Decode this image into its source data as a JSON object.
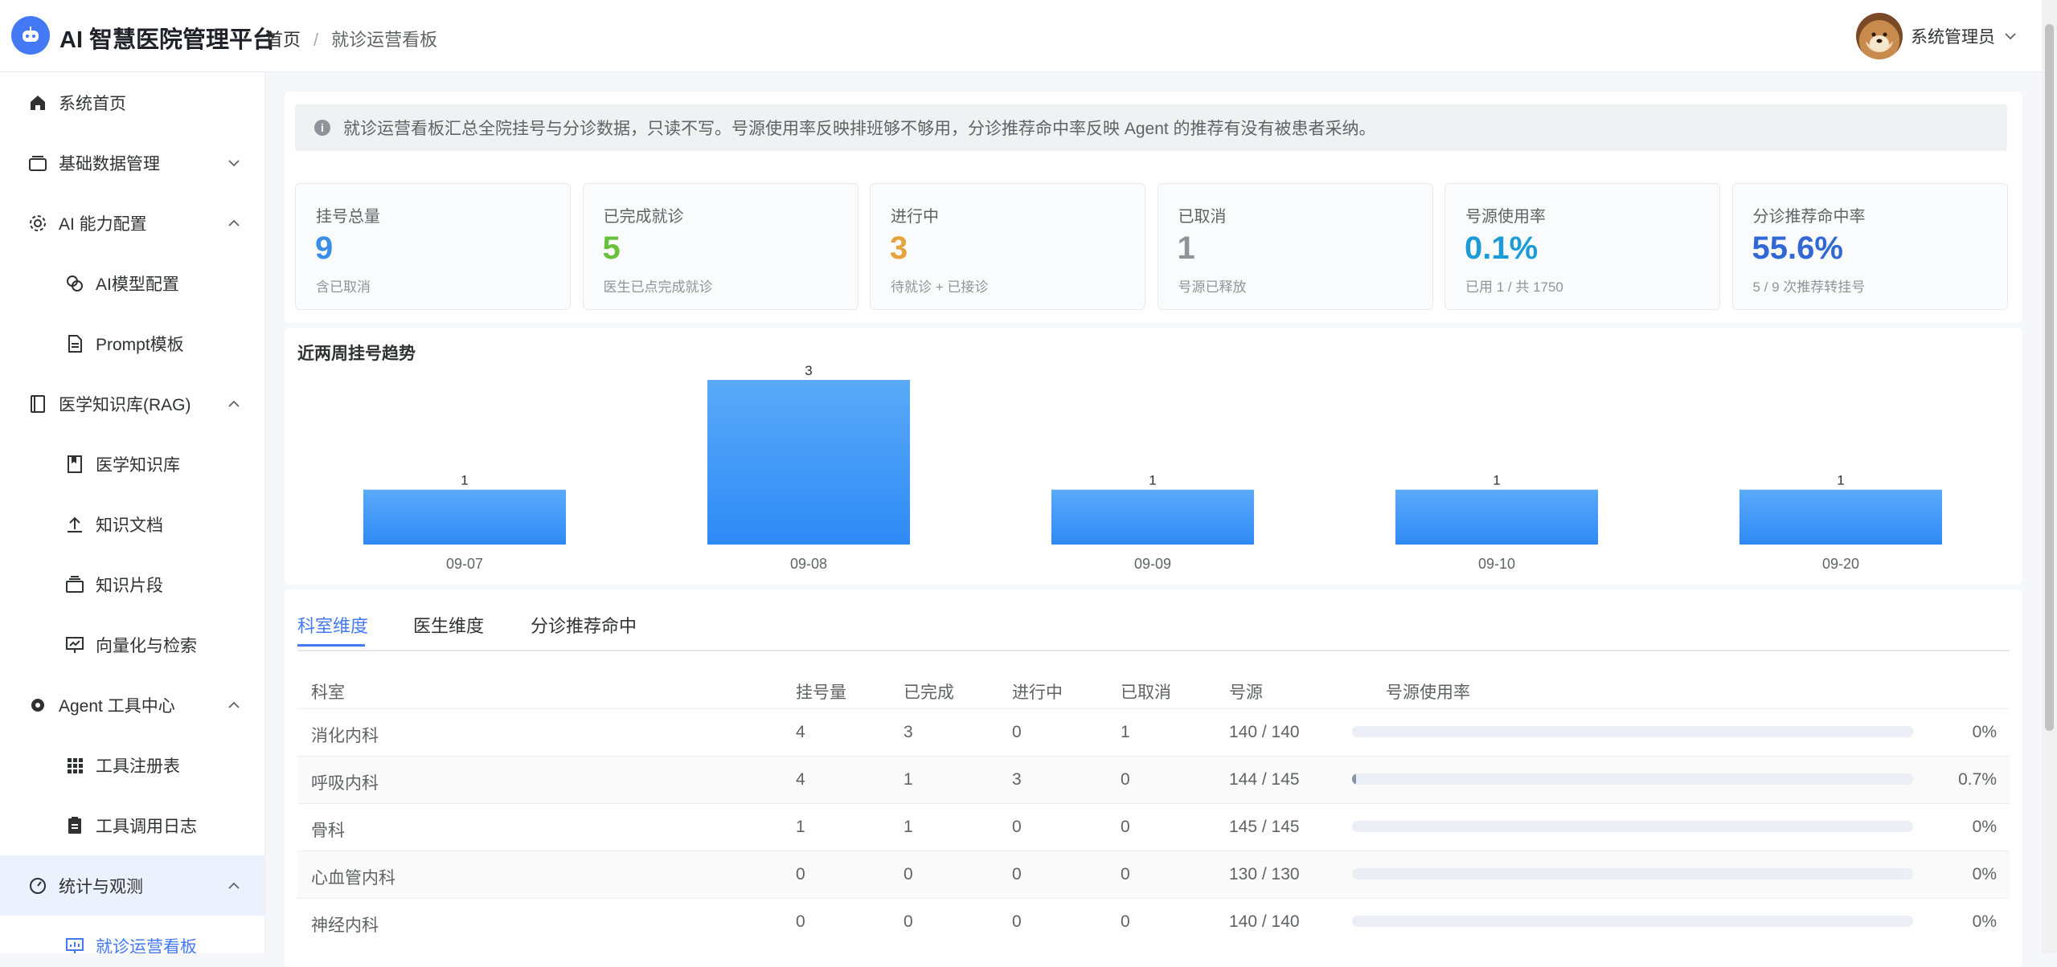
{
  "header": {
    "app_title": "AI 智慧医院管理平台",
    "breadcrumb": [
      "首页",
      "就诊运营看板"
    ],
    "user_name": "系统管理员"
  },
  "sidebar": {
    "items": [
      {
        "label": "系统首页",
        "icon": "home-icon",
        "level": 1
      },
      {
        "label": "基础数据管理",
        "icon": "folder-icon",
        "level": 1,
        "arrow": "down"
      },
      {
        "label": "AI 能力配置",
        "icon": "gear-icon",
        "level": 1,
        "arrow": "up"
      },
      {
        "label": "AI模型配置",
        "icon": "link-icon",
        "level": 2
      },
      {
        "label": "Prompt模板",
        "icon": "document-icon",
        "level": 2
      },
      {
        "label": "医学知识库(RAG)",
        "icon": "notebook-icon",
        "level": 1,
        "arrow": "up"
      },
      {
        "label": "医学知识库",
        "icon": "book-icon",
        "level": 2
      },
      {
        "label": "知识文档",
        "icon": "upload-icon",
        "level": 2
      },
      {
        "label": "知识片段",
        "icon": "stack-icon",
        "level": 2
      },
      {
        "label": "向量化与检索",
        "icon": "presentation-icon",
        "level": 2
      },
      {
        "label": "Agent 工具中心",
        "icon": "cog-icon",
        "level": 1,
        "arrow": "up"
      },
      {
        "label": "工具注册表",
        "icon": "grid-icon",
        "level": 2
      },
      {
        "label": "工具调用日志",
        "icon": "clipboard-icon",
        "level": 2
      },
      {
        "label": "统计与观测",
        "icon": "gauge-icon",
        "level": 1,
        "arrow": "up",
        "group_active": true
      },
      {
        "label": "就诊运营看板",
        "icon": "chart-icon",
        "level": 2,
        "active": true
      }
    ]
  },
  "notice": {
    "text": "就诊运营看板汇总全院挂号与分诊数据，只读不写。号源使用率反映排班够不够用，分诊推荐命中率反映 Agent 的推荐有没有被患者采纳。"
  },
  "stats": [
    {
      "label": "挂号总量",
      "value": "9",
      "sub": "含已取消",
      "color": "#3a8ee6"
    },
    {
      "label": "已完成就诊",
      "value": "5",
      "sub": "医生已点完成就诊",
      "color": "#67c23a"
    },
    {
      "label": "进行中",
      "value": "3",
      "sub": "待就诊 + 已接诊",
      "color": "#e6a23c"
    },
    {
      "label": "已取消",
      "value": "1",
      "sub": "号源已释放",
      "color": "#909399"
    },
    {
      "label": "号源使用率",
      "value": "0.1%",
      "sub": "已用 1 / 共 1750",
      "color": "#1d9bd6"
    },
    {
      "label": "分诊推荐命中率",
      "value": "55.6%",
      "sub": "5 / 9 次推荐转挂号",
      "color": "#3268d6"
    }
  ],
  "chart_data": {
    "type": "bar",
    "title": "近两周挂号趋势",
    "categories": [
      "09-07",
      "09-08",
      "09-09",
      "09-10",
      "09-20"
    ],
    "values": [
      1,
      3,
      1,
      1,
      1
    ],
    "ylim": [
      0,
      3
    ],
    "grid": false,
    "legend": "none",
    "bar_color": "#409eff"
  },
  "tabs": [
    {
      "label": "科室维度",
      "active": true
    },
    {
      "label": "医生维度",
      "active": false
    },
    {
      "label": "分诊推荐命中",
      "active": false
    }
  ],
  "table": {
    "columns": [
      "科室",
      "挂号量",
      "已完成",
      "进行中",
      "已取消",
      "号源",
      "号源使用率"
    ],
    "rows": [
      {
        "dept": "消化内科",
        "total": "4",
        "done": "3",
        "ongoing": "0",
        "cancelled": "1",
        "slots": "140 / 140",
        "usage": 0,
        "usage_label": "0%"
      },
      {
        "dept": "呼吸内科",
        "total": "4",
        "done": "1",
        "ongoing": "3",
        "cancelled": "0",
        "slots": "144 / 145",
        "usage": 0.7,
        "usage_label": "0.7%"
      },
      {
        "dept": "骨科",
        "total": "1",
        "done": "1",
        "ongoing": "0",
        "cancelled": "0",
        "slots": "145 / 145",
        "usage": 0,
        "usage_label": "0%"
      },
      {
        "dept": "心血管内科",
        "total": "0",
        "done": "0",
        "ongoing": "0",
        "cancelled": "0",
        "slots": "130 / 130",
        "usage": 0,
        "usage_label": "0%"
      },
      {
        "dept": "神经内科",
        "total": "0",
        "done": "0",
        "ongoing": "0",
        "cancelled": "0",
        "slots": "140 / 140",
        "usage": 0,
        "usage_label": "0%"
      }
    ]
  }
}
